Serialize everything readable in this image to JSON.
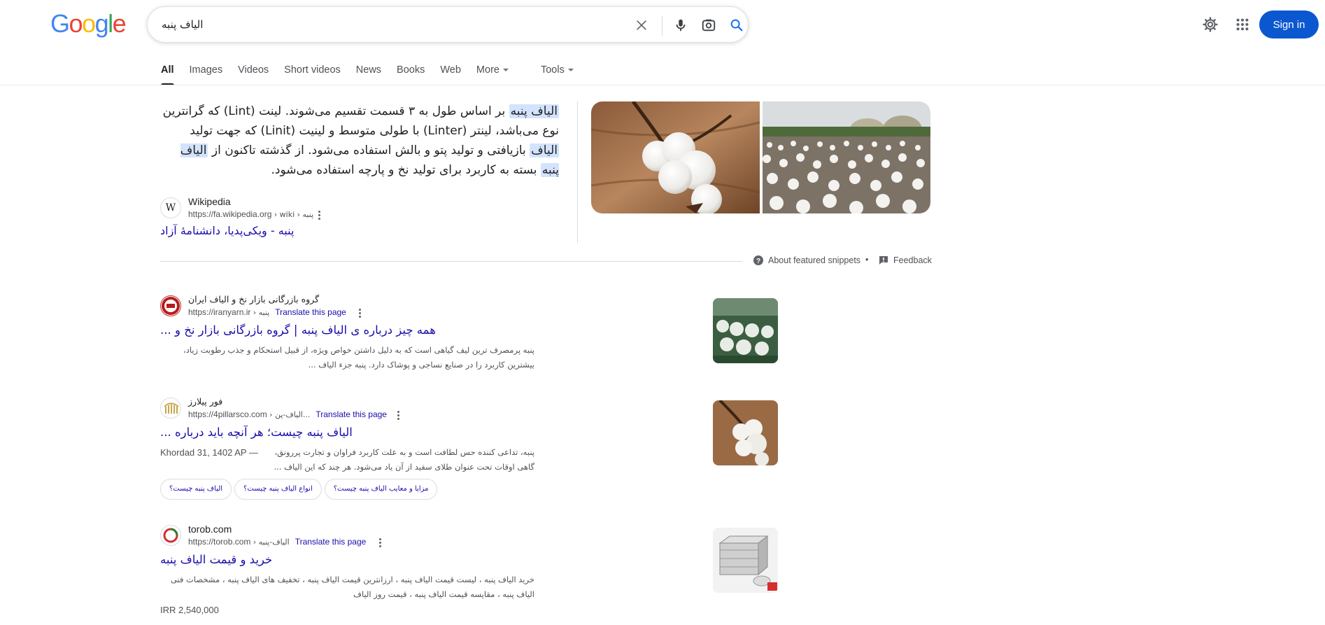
{
  "header": {
    "logo_letters": [
      {
        "ch": "G",
        "color": "#4285F4"
      },
      {
        "ch": "o",
        "color": "#EA4335"
      },
      {
        "ch": "o",
        "color": "#FBBC05"
      },
      {
        "ch": "g",
        "color": "#4285F4"
      },
      {
        "ch": "l",
        "color": "#34A853"
      },
      {
        "ch": "e",
        "color": "#EA4335"
      }
    ],
    "search_value": "الیاف پنبه",
    "sign_in_label": "Sign in",
    "accent_color": "#0b57d0"
  },
  "tabs": {
    "all": "All",
    "images": "Images",
    "videos": "Videos",
    "short_videos": "Short videos",
    "news": "News",
    "books": "Books",
    "web": "Web",
    "more": "More",
    "tools": "Tools"
  },
  "snippet": {
    "p1_hl1": "الیاف پنبه",
    "p1_rest": " بر اساس طول به ۳ قسمت تقسیم می‌شوند. لینت (Lint) که گرانترین نوع می‌باشد، لینتر (Linter) با طولی متوسط و لینیت (Linit) که جهت تولید ",
    "p1_hl2": "الیاف",
    "p1_rest2": " بازیافتی و تولید پتو و بالش استفاده می‌شود. از گذشته تاکنون از ",
    "p1_hl3": "الیاف پنبه",
    "p1_rest3": " بسته به کاربرد برای تولید نخ و پارچه استفاده می‌شود.",
    "source_name": "Wikipedia",
    "source_url": "https://fa.wikipedia.org",
    "source_crumb": "› wiki › پنبه",
    "link_title": "پنبه - ویکی‌پدیا، دانشنامهٔ آزاد",
    "about_label": "About featured snippets",
    "dot": "•",
    "feedback_label": "Feedback"
  },
  "results": [
    {
      "site_name": "گروه بازرگانی بازار نخ و الیاف ایران",
      "url": "https://iranyarn.ir",
      "crumb": "› پنبه",
      "translate": "Translate this page",
      "title": "همه چیز درباره ی الیاف پنبه | گروه بازرگانی بازار نخ و ...",
      "snippet": "پنبه پرمصرف ترین لیف گیاهی است که به دلیل داشتن خواص ویژه، از قبیل استحکام و جذب رطوبت زیاد، بیشترین کاربرد را در صنایع نساجی و پوشاک دارد. پنبه جزء الیاف ..."
    },
    {
      "site_name": "فور پیلارز",
      "url": "https://4pillarsco.com",
      "crumb": "› الیاف-پن...",
      "translate": "Translate this page",
      "title": "الیاف پنبه چیست؛ هر آنچه باید درباره ...",
      "date": "Khordad 31, 1402 AP —",
      "snippet": "پنبه، تداعی کننده حس لطافت است و به علت کاربرد فراوان و تجارت پررونق، گاهی اوقات تحت عنوان طلای سفید از آن یاد می‌شود. هر چند که این الیاف ...",
      "chips": [
        "الیاف پنبه چیست؟",
        "انواع الیاف پنبه چیست؟",
        "مزایا و معایب الیاف پنبه چیست؟"
      ]
    },
    {
      "site_name": "torob.com",
      "url": "https://torob.com",
      "crumb": "› الیاف-پنبه",
      "translate": "Translate this page",
      "title": "خرید و قیمت الیاف پنبه",
      "snippet": "خرید الیاف پنبه ، لیست قیمت الیاف پنبه ، ارزانترین قیمت الیاف پنبه ، تخفیف های الیاف پنبه ، مشخصات فنی الیاف پنبه ، مقایسه قیمت الیاف پنبه ، قیمت روز الیاف",
      "price": "IRR 2,540,000"
    }
  ]
}
